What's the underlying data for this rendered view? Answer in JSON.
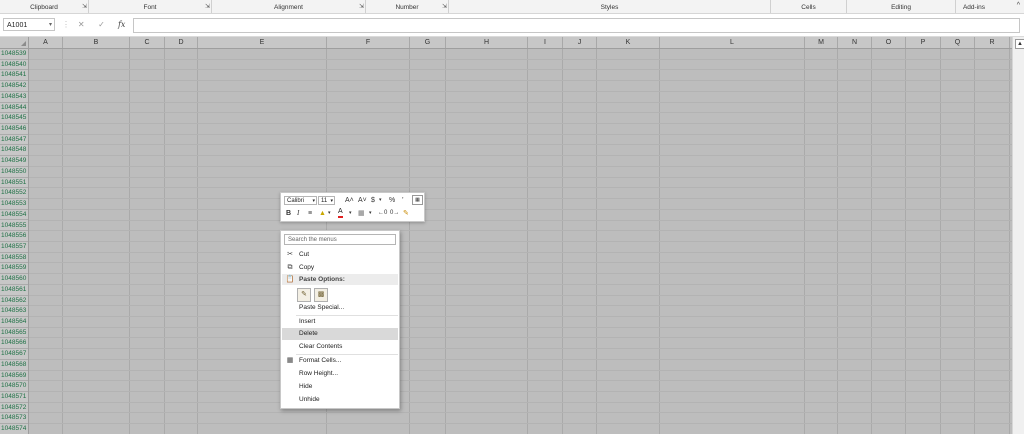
{
  "ribbon": {
    "groups": [
      "Clipboard",
      "Font",
      "Alignment",
      "Number",
      "Styles",
      "Cells",
      "Editing",
      "Add-ins"
    ],
    "collapse_icon": "^"
  },
  "formula_bar": {
    "name_box": "A1001",
    "cancel_icon": "✕",
    "enter_icon": "✓",
    "fx_label": "fx",
    "formula_value": ""
  },
  "columns": [
    "A",
    "B",
    "C",
    "D",
    "E",
    "F",
    "G",
    "H",
    "I",
    "J",
    "K",
    "L",
    "M",
    "N",
    "O",
    "P",
    "Q",
    "R"
  ],
  "rows": [
    "1048539",
    "1048540",
    "1048541",
    "1048542",
    "1048543",
    "1048544",
    "1048545",
    "1048546",
    "1048547",
    "1048548",
    "1048549",
    "1048550",
    "1048551",
    "1048552",
    "1048553",
    "1048554",
    "1048555",
    "1048556",
    "1048557",
    "1048558",
    "1048559",
    "1048560",
    "1048561",
    "1048562",
    "1048563",
    "1048564",
    "1048565",
    "1048566",
    "1048567",
    "1048568",
    "1048569",
    "1048570",
    "1048571",
    "1048572",
    "1048573",
    "1048574"
  ],
  "mini_toolbar": {
    "font": "Calibri",
    "size": "11",
    "grow": "A˄",
    "shrink": "A˅",
    "currency": "$",
    "percent": "%",
    "comma": "’",
    "bold": "B",
    "italic": "I",
    "font_color_letter": "A"
  },
  "context_menu": {
    "search_placeholder": "Search the menus",
    "items": {
      "cut": "Cut",
      "copy": "Copy",
      "paste_options": "Paste Options:",
      "paste_special": "Paste Special...",
      "insert": "Insert",
      "delete": "Delete",
      "clear_contents": "Clear Contents",
      "format_cells": "Format Cells...",
      "row_height": "Row Height...",
      "hide": "Hide",
      "unhide": "Unhide"
    }
  }
}
